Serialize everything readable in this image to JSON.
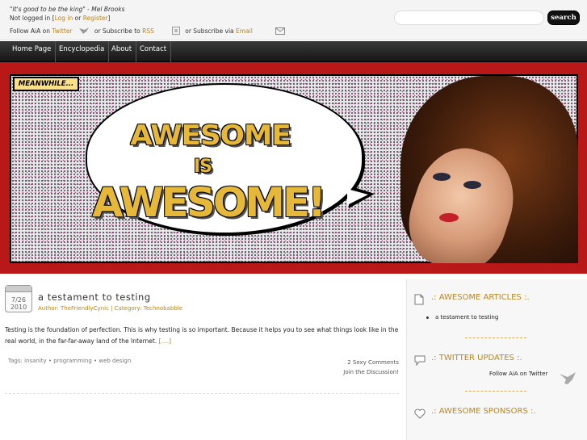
{
  "topbar": {
    "quote": "\"It's good to be the king\" - Mel Brooks",
    "login_prefix": "Not logged in [",
    "login_link": "Log in",
    "login_or": " or ",
    "register_link": "Register",
    "login_suffix": "]",
    "follow_prefix": "Follow AiA on ",
    "twitter_link": "Twitter",
    "rss_prefix": "or Subscribe to ",
    "rss_link": "RSS",
    "email_prefix": "or Subscribe via ",
    "email_link": "Email",
    "icons": {
      "twitter": "bird-icon",
      "rss": "rss-icon",
      "email": "envelope-icon"
    }
  },
  "search": {
    "placeholder": "",
    "button_label": "search"
  },
  "nav": {
    "items": [
      "Home Page",
      "Encyclopedia",
      "About",
      "Contact"
    ]
  },
  "banner": {
    "caption": "MEANWHILE...",
    "line1": "AWESOME",
    "line2": "IS",
    "line3": "AWESOME!",
    "colors": {
      "background": "#b91818",
      "text_fill": "#e6b83a"
    }
  },
  "post": {
    "date_day": "7/26",
    "date_year": "2010",
    "title": "a testament to testing",
    "meta": "Author: TheFriendlyCynic | Category: Technobabble",
    "body": "Testing is the foundation of perfection. This is why testing is so important. Because it helps you to see what things look like in the real world, in the far-far-away land of the Internet.",
    "more_link": "[....]",
    "tags": "Tags: insanity • programming • web design",
    "comments": "2 Sexy Comments",
    "discussion": "Join the Discussion!"
  },
  "sidebar": {
    "articles_heading": ".: AWESOME ARTICLES :.",
    "articles": [
      "a testament to testing"
    ],
    "twitter_heading": ".: TWITTER UPDATES :.",
    "twitter_follow": "Follow AiA on Twitter",
    "sponsors_heading": ".: AWESOME SPONSORS :."
  },
  "accent_color": "#b8861c"
}
